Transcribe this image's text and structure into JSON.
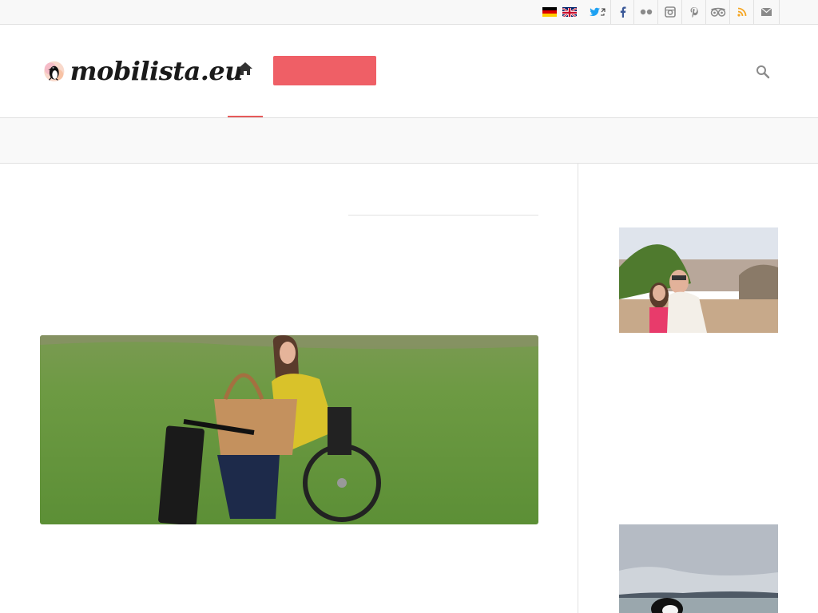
{
  "topbar": {
    "languages": [
      "german-flag",
      "english-flag"
    ],
    "social_icons": [
      "twitter-icon",
      "facebook-icon",
      "flickr-icon",
      "instagram-icon",
      "pinterest-icon",
      "tripadvisor-icon",
      "rss-icon",
      "mail-icon"
    ]
  },
  "header": {
    "logo_text": "mobilista.eu",
    "icons": [
      "home-icon",
      "search-icon"
    ]
  },
  "colors": {
    "accent": "#ef5f66",
    "twitter": "#1da1f2",
    "facebook": "#3b5998",
    "rss": "#f5a623",
    "text": "#1a1a1a",
    "border": "#e1e1e1"
  }
}
